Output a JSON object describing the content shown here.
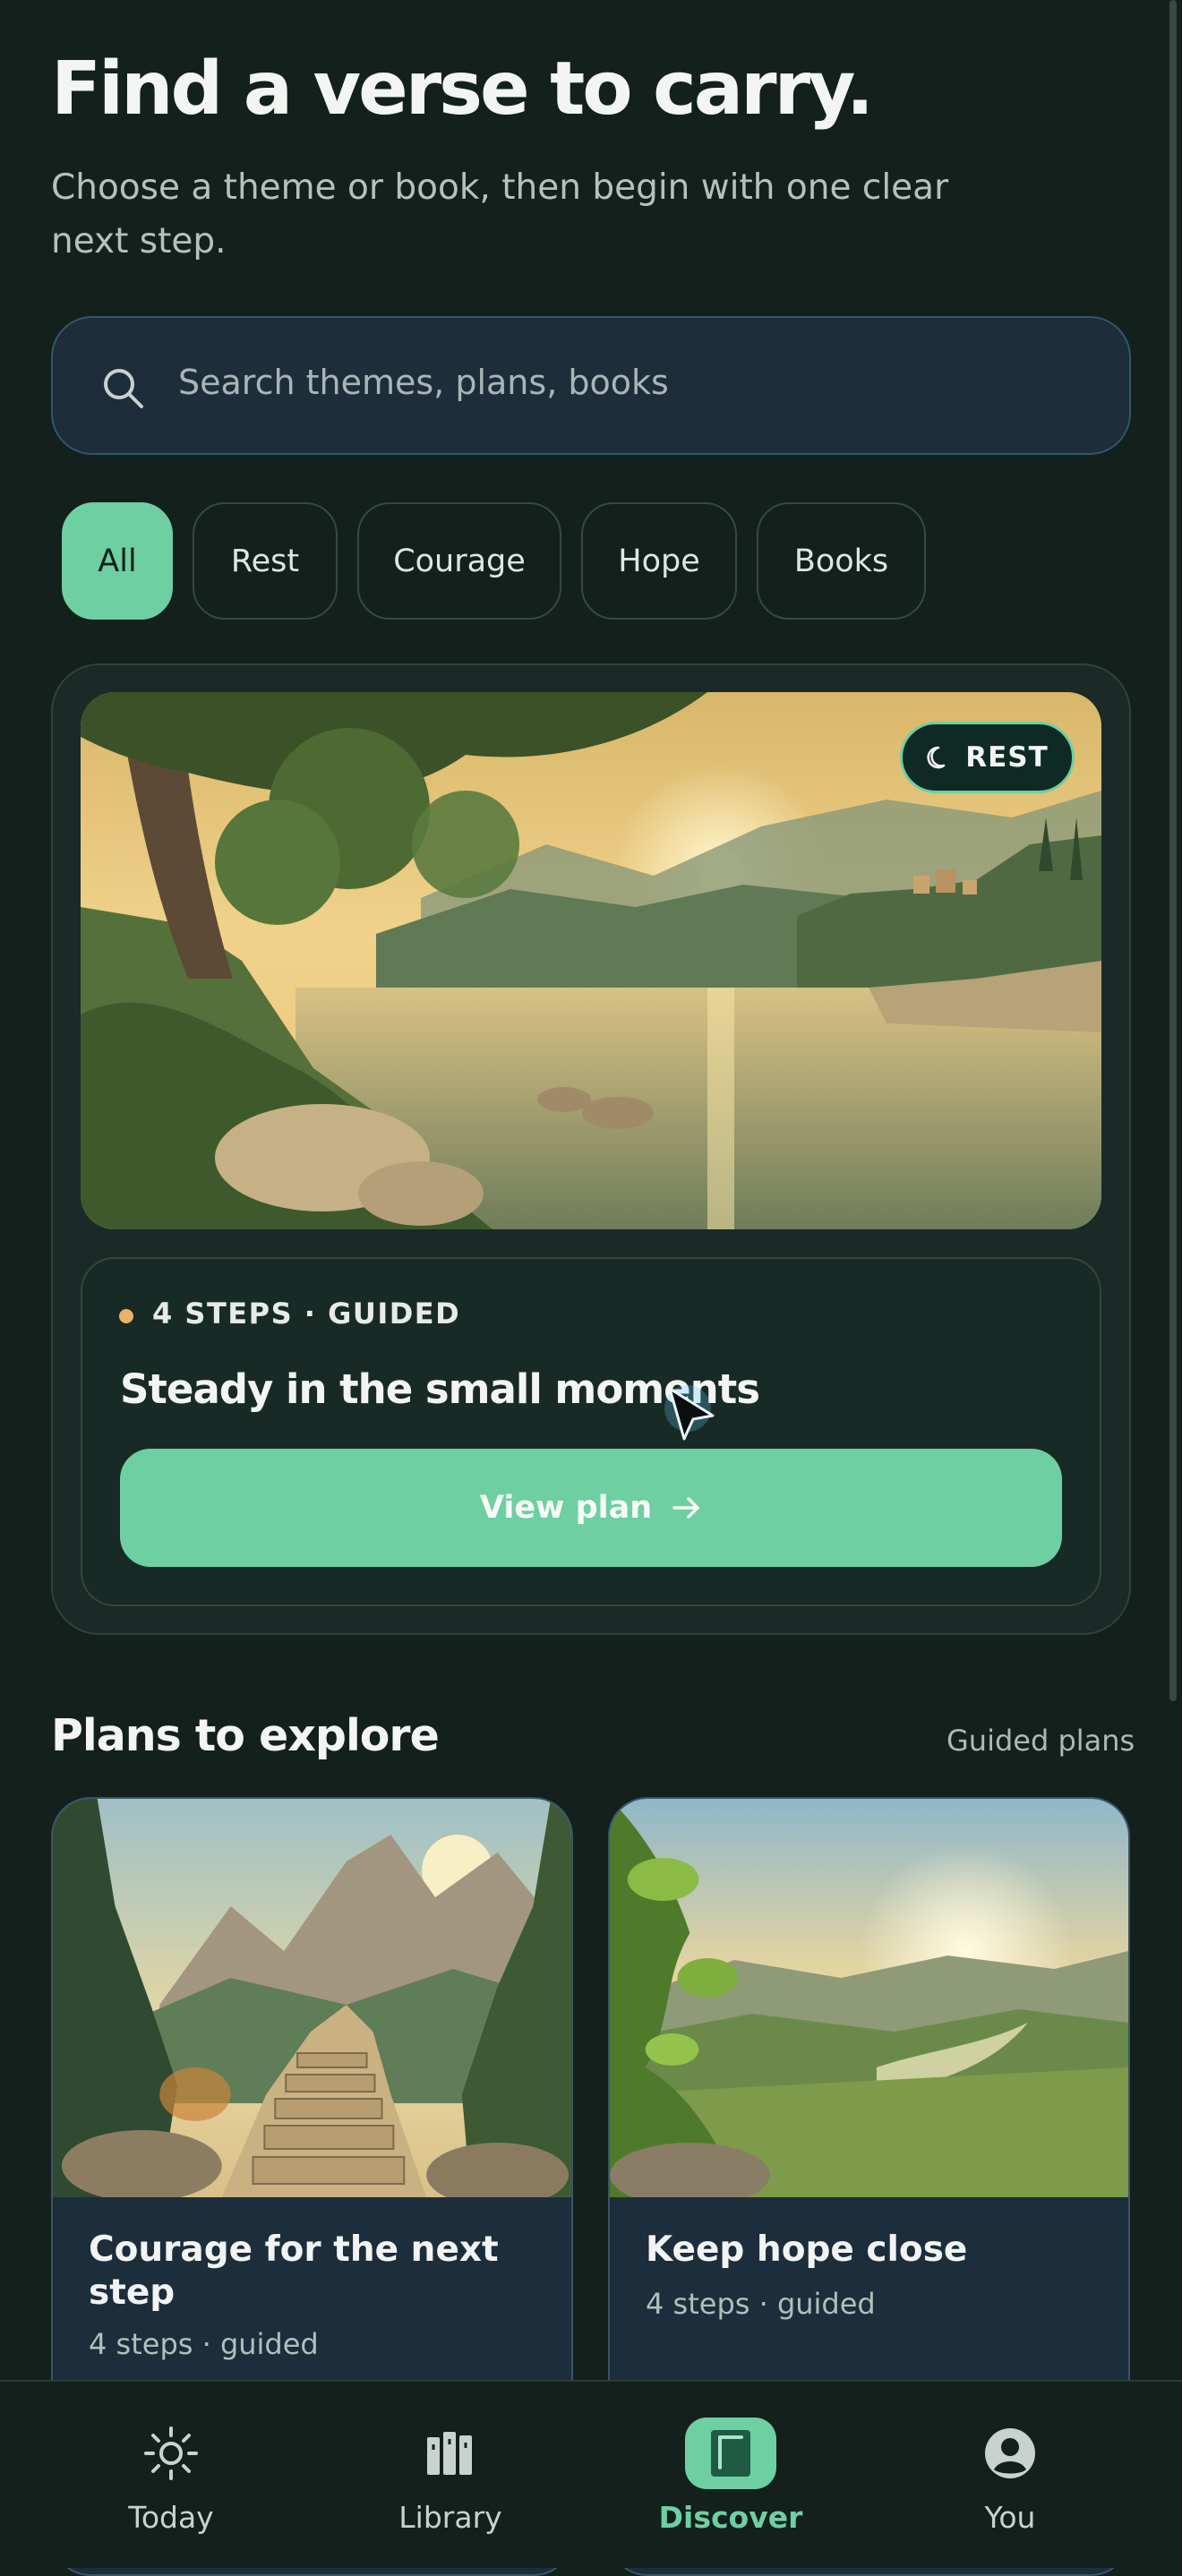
{
  "header": {
    "title": "Find a verse to carry.",
    "subtitle": "Choose a theme or book, then begin with one clear next step."
  },
  "search": {
    "placeholder": "Search themes, plans, books",
    "icon": "search-icon"
  },
  "filters": [
    {
      "label": "All",
      "selected": true
    },
    {
      "label": "Rest",
      "selected": false
    },
    {
      "label": "Courage",
      "selected": false
    },
    {
      "label": "Hope",
      "selected": false
    },
    {
      "label": "Books",
      "selected": false
    }
  ],
  "featured": {
    "badge": "REST",
    "badge_icon": "moon-icon",
    "meta": "4 STEPS · GUIDED",
    "title": "Steady in the small moments",
    "button": "View plan",
    "image": "lake-sunset-olive-trees"
  },
  "plans_section": {
    "heading": "Plans to explore",
    "link": "Guided plans",
    "plans": [
      {
        "title": "Courage for the next step",
        "meta": "4 steps · guided",
        "image": "mountain-stone-path"
      },
      {
        "title": "Keep hope close",
        "meta": "4 steps · guided",
        "image": "sunrise-valley-river"
      }
    ]
  },
  "nav": [
    {
      "label": "Today",
      "icon": "sun-icon",
      "active": false
    },
    {
      "label": "Library",
      "icon": "books-icon",
      "active": false
    },
    {
      "label": "Discover",
      "icon": "book-icon",
      "active": true
    },
    {
      "label": "You",
      "icon": "person-icon",
      "active": false
    }
  ],
  "colors": {
    "background": "#13201c",
    "accent": "#6ecfa3",
    "dot": "#e7b565"
  }
}
